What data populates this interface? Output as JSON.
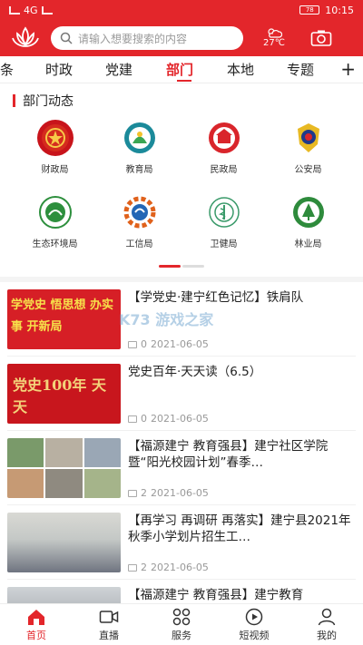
{
  "status": {
    "time": "10:15",
    "battery": "78",
    "network": "4G"
  },
  "header": {
    "search_placeholder": "请输入想要搜索的内容",
    "temperature": "27℃"
  },
  "tabs": [
    "条",
    "时政",
    "党建",
    "部门",
    "本地",
    "专题"
  ],
  "active_tab": "部门",
  "section": {
    "title": "部门动态"
  },
  "departments": [
    {
      "label": "财政局",
      "icon": "emblem-icon"
    },
    {
      "label": "教育局",
      "icon": "education-icon"
    },
    {
      "label": "民政局",
      "icon": "civil-affairs-icon"
    },
    {
      "label": "公安局",
      "icon": "police-badge-icon"
    },
    {
      "label": "生态环境局",
      "icon": "ecology-icon"
    },
    {
      "label": "工信局",
      "icon": "industry-gear-icon"
    },
    {
      "label": "卫健局",
      "icon": "health-icon"
    },
    {
      "label": "林业局",
      "icon": "forestry-icon"
    }
  ],
  "news": [
    {
      "title": "【学党史·建宁红色记忆】铁肩队",
      "comments": "0",
      "date": "2021-06-05",
      "thumb_text": "学党史 悟思想 办实事 开新局"
    },
    {
      "title": "党史百年·天天读（6.5）",
      "comments": "0",
      "date": "2021-06-05",
      "thumb_text": "党史100年 天天"
    },
    {
      "title": "【福源建宁 教育强县】建宁社区学院暨“阳光校园计划”春季…",
      "comments": "2",
      "date": "2021-06-05",
      "thumb_text": ""
    },
    {
      "title": "【再学习 再调研 再落实】建宁县2021年秋季小学划片招生工…",
      "comments": "2",
      "date": "2021-06-05",
      "thumb_text": ""
    },
    {
      "title": "【福源建宁 教育强县】建宁教育",
      "comments": "",
      "date": "",
      "thumb_text": ""
    }
  ],
  "watermark": "K73 游戏之家",
  "bottom_nav": [
    "首页",
    "直播",
    "服务",
    "短视频",
    "我的"
  ],
  "colors": {
    "accent": "#e3262b"
  }
}
